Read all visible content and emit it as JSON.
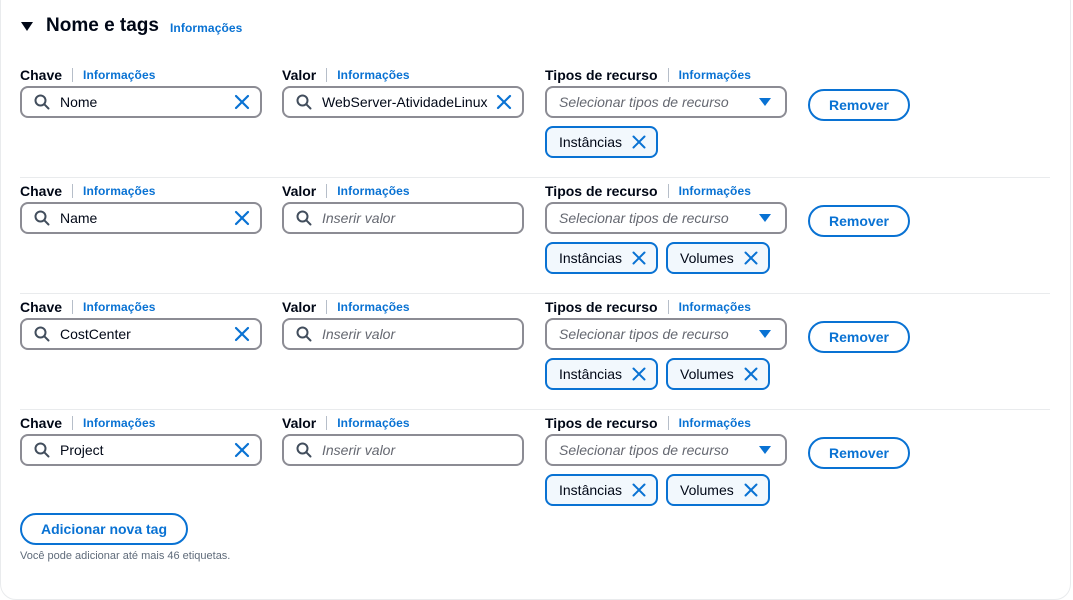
{
  "section": {
    "title": "Nome e tags",
    "info_link": "Informações"
  },
  "labels": {
    "key": "Chave",
    "value": "Valor",
    "resource_types": "Tipos de recurso",
    "info": "Informações",
    "value_placeholder": "Inserir valor",
    "resource_placeholder": "Selecionar tipos de recurso",
    "remove": "Remover"
  },
  "tags": [
    {
      "key": "Nome",
      "value": "WebServer-AtividadeLinux",
      "resource_tokens": [
        "Instâncias"
      ]
    },
    {
      "key": "Name",
      "value": "",
      "resource_tokens": [
        "Instâncias",
        "Volumes"
      ]
    },
    {
      "key": "CostCenter",
      "value": "",
      "resource_tokens": [
        "Instâncias",
        "Volumes"
      ]
    },
    {
      "key": "Project",
      "value": "",
      "resource_tokens": [
        "Instâncias",
        "Volumes"
      ]
    }
  ],
  "add_button": "Adicionar nova tag",
  "hint": "Você pode adicionar até mais 46 etiquetas.",
  "colors": {
    "accent": "#0972d3",
    "token_background": "#f2f8fd",
    "input_border": "#8c8c94",
    "divider": "#e9ebed"
  }
}
